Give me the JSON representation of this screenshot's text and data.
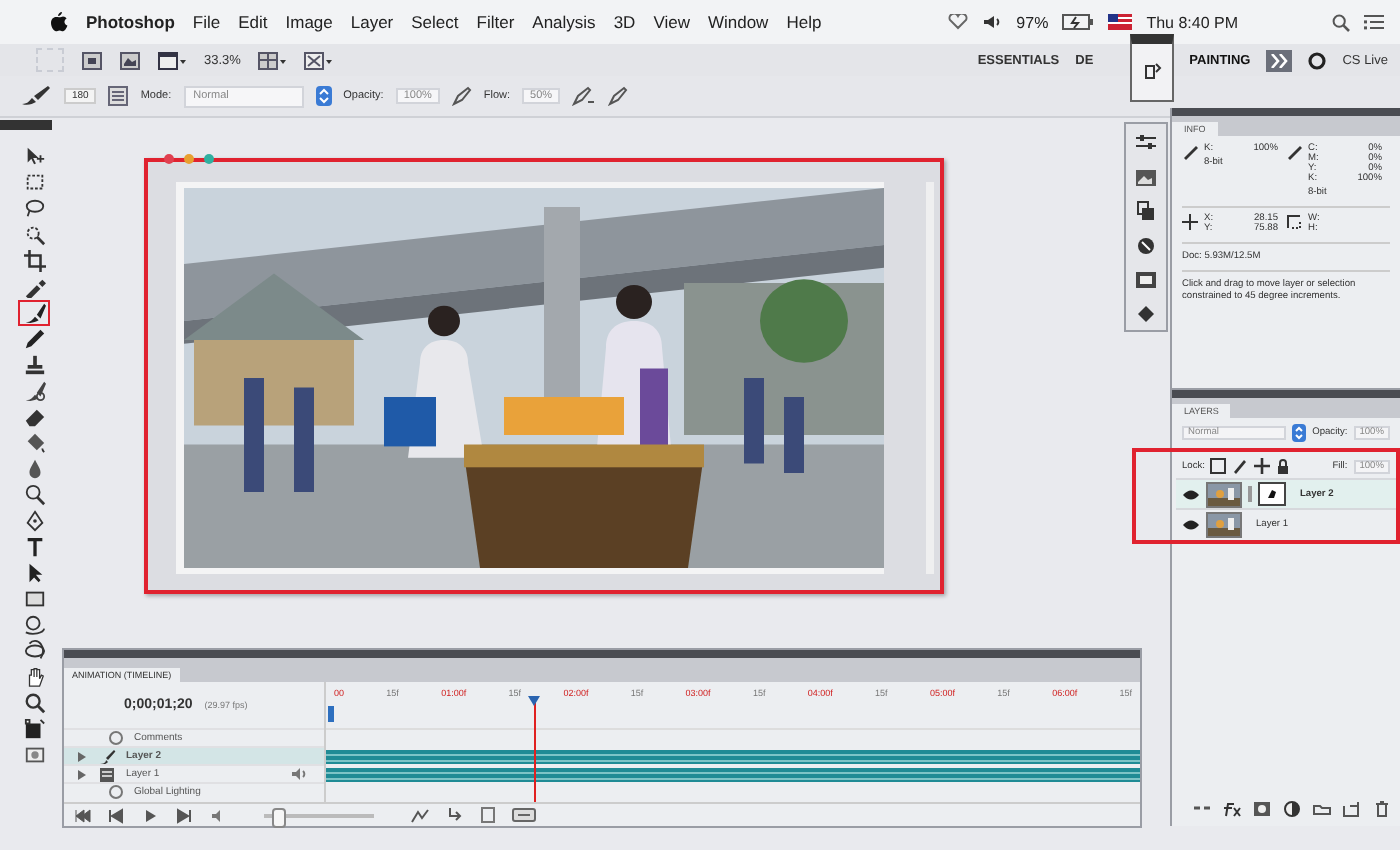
{
  "menu_bar": {
    "app": "Photoshop",
    "items": [
      "File",
      "Edit",
      "Image",
      "Layer",
      "Select",
      "Filter",
      "Analysis",
      "3D",
      "View",
      "Window",
      "Help"
    ],
    "battery": "97%",
    "clock": "Thu 8:40 PM"
  },
  "app_bar": {
    "zoom": "33.3%",
    "workspaces": [
      {
        "label": "ESSENTIALS",
        "selected": false
      },
      {
        "label": "DE",
        "selected": false
      },
      {
        "label": "PAINTING",
        "selected": true
      }
    ],
    "cs_live": "CS Live"
  },
  "options_bar": {
    "brush_size": "180",
    "mode_label": "Mode:",
    "mode": "Normal",
    "opacity_label": "Opacity:",
    "opacity": "100%",
    "flow_label": "Flow:",
    "flow": "50%"
  },
  "tools": [
    {
      "kind": "move",
      "highlighted": false
    },
    {
      "kind": "marquee",
      "highlighted": false
    },
    {
      "kind": "lasso",
      "highlighted": false
    },
    {
      "kind": "quick-select",
      "highlighted": false
    },
    {
      "kind": "crop",
      "highlighted": false
    },
    {
      "kind": "eyedropper",
      "highlighted": false
    },
    {
      "kind": "brush",
      "highlighted": true
    },
    {
      "kind": "pencil",
      "highlighted": false
    },
    {
      "kind": "stamp",
      "highlighted": false
    },
    {
      "kind": "history",
      "highlighted": false
    },
    {
      "kind": "eraser",
      "highlighted": false
    },
    {
      "kind": "bucket",
      "highlighted": false
    },
    {
      "kind": "blur",
      "highlighted": false
    },
    {
      "kind": "dodge",
      "highlighted": false
    },
    {
      "kind": "pen",
      "highlighted": false
    },
    {
      "kind": "type",
      "highlighted": false
    },
    {
      "kind": "path",
      "highlighted": false
    },
    {
      "kind": "shape",
      "highlighted": false
    },
    {
      "kind": "rotate3d",
      "highlighted": false
    },
    {
      "kind": "orbit3d",
      "highlighted": false
    },
    {
      "kind": "hand",
      "highlighted": false
    },
    {
      "kind": "zoom",
      "highlighted": false
    },
    {
      "kind": "colors",
      "highlighted": false
    },
    {
      "kind": "mask",
      "highlighted": false
    }
  ],
  "document": {
    "kind": "picture",
    "highlighted": true
  },
  "info": {
    "title": "INFO",
    "left": [
      {
        "label": "K:",
        "value": "100%"
      }
    ],
    "left_depth": "8-bit",
    "right": [
      {
        "label": "C:",
        "value": "0%"
      },
      {
        "label": "M:",
        "value": "0%"
      },
      {
        "label": "Y:",
        "value": "0%"
      },
      {
        "label": "K:",
        "value": "100%"
      }
    ],
    "right_depth": "8-bit",
    "position": [
      {
        "label": "X:",
        "value": "28.15"
      },
      {
        "label": "Y:",
        "value": "75.88"
      }
    ],
    "size": [
      {
        "label": "W:"
      },
      {
        "label": "H:"
      }
    ],
    "doc": "Doc: 5.93M/12.5M",
    "hint": "Click and drag to move layer or selection constrained to 45 degree increments."
  },
  "layers": {
    "title": "LAYERS",
    "blend": "Normal",
    "opacity_label": "Opacity:",
    "opacity": "100%",
    "lock_label": "Lock:",
    "fill_label": "Fill:",
    "fill": "100%",
    "highlighted": true,
    "rows": [
      {
        "name": "Layer 2",
        "selected": true,
        "visible": true,
        "mask": true
      },
      {
        "name": "Layer 1",
        "selected": false,
        "visible": true,
        "mask": false
      }
    ]
  },
  "timeline": {
    "title": "ANIMATION (TIMELINE)",
    "timecode": "0;00;01;20",
    "fps": "(29.97 fps)",
    "ruler": [
      {
        "label": "00",
        "major": true
      },
      {
        "label": "15f",
        "major": false
      },
      {
        "label": "01:00f",
        "major": true
      },
      {
        "label": "15f",
        "major": false
      },
      {
        "label": "02:00f",
        "major": true
      },
      {
        "label": "15f",
        "major": false
      },
      {
        "label": "03:00f",
        "major": true
      },
      {
        "label": "15f",
        "major": false
      },
      {
        "label": "04:00f",
        "major": true
      },
      {
        "label": "15f",
        "major": false
      },
      {
        "label": "05:00f",
        "major": true
      },
      {
        "label": "15f",
        "major": false
      },
      {
        "label": "06:00f",
        "major": true
      },
      {
        "label": "15f",
        "major": false
      }
    ],
    "playhead": {
      "level": 0.255
    },
    "zoom_slider": {
      "level": 0.1
    },
    "tracks": [
      {
        "kind": "comments",
        "name": "Comments",
        "selected": false
      },
      {
        "kind": "layer",
        "name": "Layer 2",
        "selected": true
      },
      {
        "kind": "layer",
        "name": "Layer 1",
        "selected": false
      },
      {
        "kind": "lighting",
        "name": "Global Lighting",
        "selected": false
      }
    ]
  }
}
